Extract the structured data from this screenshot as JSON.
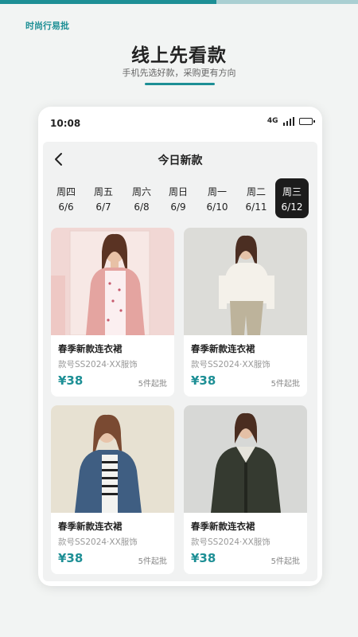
{
  "brand": "时尚行易批",
  "headline": "线上先看款",
  "subhead": "手机先选好款，采购更有方向",
  "colors": {
    "accent": "#1d8f95",
    "active_day": "#1c1c1c"
  },
  "status": {
    "time": "10:08",
    "network": "4G",
    "icons": [
      "signal-icon",
      "battery-icon"
    ]
  },
  "nav": {
    "title": "今日新款",
    "back_icon": "chevron-left-icon"
  },
  "days": [
    {
      "weekday": "周四",
      "date": "6/6",
      "active": false
    },
    {
      "weekday": "周五",
      "date": "6/7",
      "active": false
    },
    {
      "weekday": "周六",
      "date": "6/8",
      "active": false
    },
    {
      "weekday": "周日",
      "date": "6/9",
      "active": false
    },
    {
      "weekday": "周一",
      "date": "6/10",
      "active": false
    },
    {
      "weekday": "周二",
      "date": "6/11",
      "active": false
    },
    {
      "weekday": "周三",
      "date": "6/12",
      "active": true
    }
  ],
  "products": [
    {
      "title": "春季新款连衣裙",
      "sku": "款号SS2024·XX服饰",
      "price": "¥38",
      "min_order": "5件起批"
    },
    {
      "title": "春季新款连衣裙",
      "sku": "款号SS2024·XX服饰",
      "price": "¥38",
      "min_order": "5件起批"
    },
    {
      "title": "春季新款连衣裙",
      "sku": "款号SS2024·XX服饰",
      "price": "¥38",
      "min_order": "5件起批"
    },
    {
      "title": "春季新款连衣裙",
      "sku": "款号SS2024·XX服饰",
      "price": "¥38",
      "min_order": "5件起批"
    }
  ]
}
